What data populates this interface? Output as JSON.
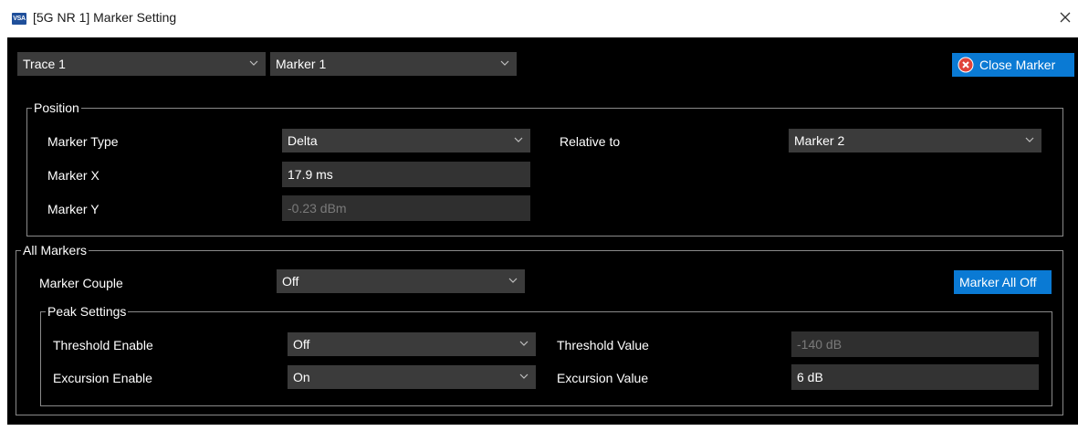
{
  "window": {
    "title": "[5G NR 1] Marker Setting",
    "icon_text": "VSA"
  },
  "top": {
    "trace_select": "Trace 1",
    "marker_select": "Marker 1",
    "close_marker_label": "Close Marker"
  },
  "position": {
    "group_title": "Position",
    "marker_type_label": "Marker Type",
    "marker_type_value": "Delta",
    "relative_to_label": "Relative to",
    "relative_to_value": "Marker 2",
    "marker_x_label": "Marker X",
    "marker_x_value": "17.9 ms",
    "marker_y_label": "Marker Y",
    "marker_y_value": "-0.23 dBm"
  },
  "all_markers": {
    "group_title": "All Markers",
    "marker_couple_label": "Marker Couple",
    "marker_couple_value": "Off",
    "marker_all_off_label": "Marker All Off"
  },
  "peak": {
    "group_title": "Peak Settings",
    "threshold_enable_label": "Threshold Enable",
    "threshold_enable_value": "Off",
    "threshold_value_label": "Threshold Value",
    "threshold_value_value": "-140 dB",
    "excursion_enable_label": "Excursion Enable",
    "excursion_enable_value": "On",
    "excursion_value_label": "Excursion Value",
    "excursion_value_value": "6 dB"
  },
  "colors": {
    "accent": "#0a7ad4",
    "background": "#000000",
    "close_icon": "#e0443a"
  },
  "icons": [
    "close-window-icon",
    "chevron-down-icon",
    "close-circle-icon"
  ]
}
